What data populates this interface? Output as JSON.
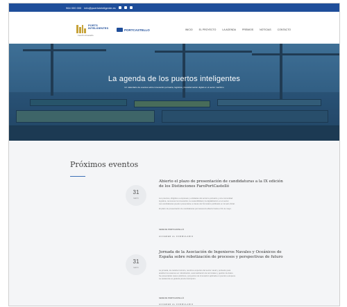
{
  "topbar": {
    "phone": "964 000 000",
    "email": "info@puertointeligente.es"
  },
  "header": {
    "logo1_text": "PORTS INTELIGENTES",
    "logo1_sub": "FaroPortCastelló",
    "logo2_text": "PORTCASTELLO",
    "nav": [
      "INICIO",
      "EL PROYECTO",
      "LA AGENDA",
      "PREMIOS",
      "NOTICIAS",
      "CONTACTO"
    ]
  },
  "hero": {
    "title": "La agenda de los puertos inteligentes",
    "subtitle": "Un calendario de eventos sobre innovación portuaria, logística y transformación digital en el sector marítimo"
  },
  "section": {
    "title": "Próximos eventos"
  },
  "events": [
    {
      "day": "31",
      "month": "MAYO",
      "title": "Abierto el plazo de presentación de candidaturas a la IX edición de los Distinciones FaroPortCastelló",
      "body": [
        "Los premios, dirigidos a empresas y entidades del entorno portuario y a la comunidad",
        "logística, reconocen la innovación, la sostenibilidad y la digitalización en el sector.",
        "Las candidaturas pueden presentarse a través del formulario publicado en la web oficial.",
        "El plazo de presentación de candidaturas permanecerá abierto hasta el 31 de mayo."
      ],
      "location": "SEDE DE PORTCASTELLÓ",
      "link": "ACCEDER AL FORMULARIO"
    },
    {
      "day": "31",
      "month": "MAYO",
      "title": "Jornada de la Asociación de Ingenieros Navales y Oceánicos de España sobre robotización de procesos y perspectivas de futuro",
      "body": [
        "La jornada, de carácter técnico, reunirá a expertos del sector naval y portuario para",
        "analizar los avances en robotización, automatización de terminales y gestión de datos.",
        "Se presentarán casos prácticos y proyectos de innovación aplicada en puertos europeos.",
        "La asistencia es gratuita previa inscripción."
      ],
      "location": "SEDE DE PORTCASTELLÓ",
      "link": "ACCEDER AL FORMULARIO"
    }
  ]
}
